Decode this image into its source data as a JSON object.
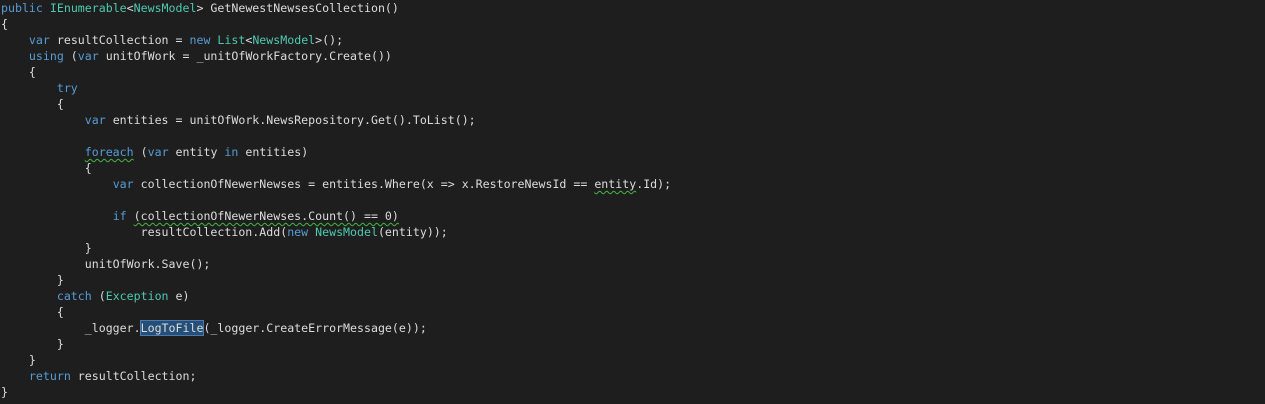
{
  "code": {
    "lines": [
      [
        {
          "t": "public",
          "c": "kw"
        },
        {
          "t": " "
        },
        {
          "t": "IEnumerable",
          "c": "ty"
        },
        {
          "t": "<"
        },
        {
          "t": "NewsModel",
          "c": "ty"
        },
        {
          "t": "> GetNewestNewsesCollection()"
        }
      ],
      [
        {
          "t": "{"
        }
      ],
      [
        {
          "t": "    "
        },
        {
          "t": "var",
          "c": "kw"
        },
        {
          "t": " resultCollection = "
        },
        {
          "t": "new",
          "c": "kw"
        },
        {
          "t": " "
        },
        {
          "t": "List",
          "c": "ty"
        },
        {
          "t": "<"
        },
        {
          "t": "NewsModel",
          "c": "ty"
        },
        {
          "t": ">();"
        }
      ],
      [
        {
          "t": "    "
        },
        {
          "t": "using",
          "c": "kw"
        },
        {
          "t": " ("
        },
        {
          "t": "var",
          "c": "kw"
        },
        {
          "t": " unitOfWork = _unitOfWorkFactory.Create())"
        }
      ],
      [
        {
          "t": "    {"
        }
      ],
      [
        {
          "t": "        "
        },
        {
          "t": "try",
          "c": "kw"
        }
      ],
      [
        {
          "t": "        {"
        }
      ],
      [
        {
          "t": "            "
        },
        {
          "t": "var",
          "c": "kw"
        },
        {
          "t": " entities = unitOfWork.NewsRepository.Get().ToList();"
        }
      ],
      [],
      [
        {
          "t": "            "
        },
        {
          "t": "foreach",
          "c": "kw",
          "s": "squig"
        },
        {
          "t": " ("
        },
        {
          "t": "var",
          "c": "kw"
        },
        {
          "t": " entity "
        },
        {
          "t": "in",
          "c": "kw"
        },
        {
          "t": " entities)"
        }
      ],
      [
        {
          "t": "            {"
        }
      ],
      [
        {
          "t": "                "
        },
        {
          "t": "var",
          "c": "kw"
        },
        {
          "t": " collectionOfNewerNewses = entities.Where(x => x.RestoreNewsId == "
        },
        {
          "t": "entity",
          "s": "squig"
        },
        {
          "t": ".Id);"
        }
      ],
      [],
      [
        {
          "t": "                "
        },
        {
          "t": "if",
          "c": "kw"
        },
        {
          "t": " "
        },
        {
          "t": "(collectionOfNewerNewses.Count() == 0)",
          "s": "squig"
        }
      ],
      [
        {
          "t": "                    resultCollection.Add("
        },
        {
          "t": "new",
          "c": "kw"
        },
        {
          "t": " "
        },
        {
          "t": "NewsModel",
          "c": "ty"
        },
        {
          "t": "(entity));"
        }
      ],
      [
        {
          "t": "            }"
        }
      ],
      [
        {
          "t": "            unitOfWork.Save();"
        }
      ],
      [
        {
          "t": "        }"
        }
      ],
      [
        {
          "t": "        "
        },
        {
          "t": "catch",
          "c": "kw"
        },
        {
          "t": " ("
        },
        {
          "t": "Exception",
          "c": "ty"
        },
        {
          "t": " e)"
        }
      ],
      [
        {
          "t": "        {"
        }
      ],
      [
        {
          "t": "            _logger."
        },
        {
          "t": "LogToFile",
          "s": "sel"
        },
        {
          "t": "(_logger.CreateErrorMessage(e));"
        }
      ],
      [
        {
          "t": "        }"
        }
      ],
      [
        {
          "t": "    }"
        }
      ],
      [
        {
          "t": "    "
        },
        {
          "t": "return",
          "c": "kw"
        },
        {
          "t": " resultCollection;"
        }
      ],
      [
        {
          "t": "}"
        }
      ]
    ]
  },
  "colors": {
    "background": "#1e1e1e",
    "keyword": "#569cd6",
    "type": "#4ec9b0",
    "identifier": "#dcdcdc",
    "squiggle": "#3fb93f",
    "selection": "#264f78"
  }
}
